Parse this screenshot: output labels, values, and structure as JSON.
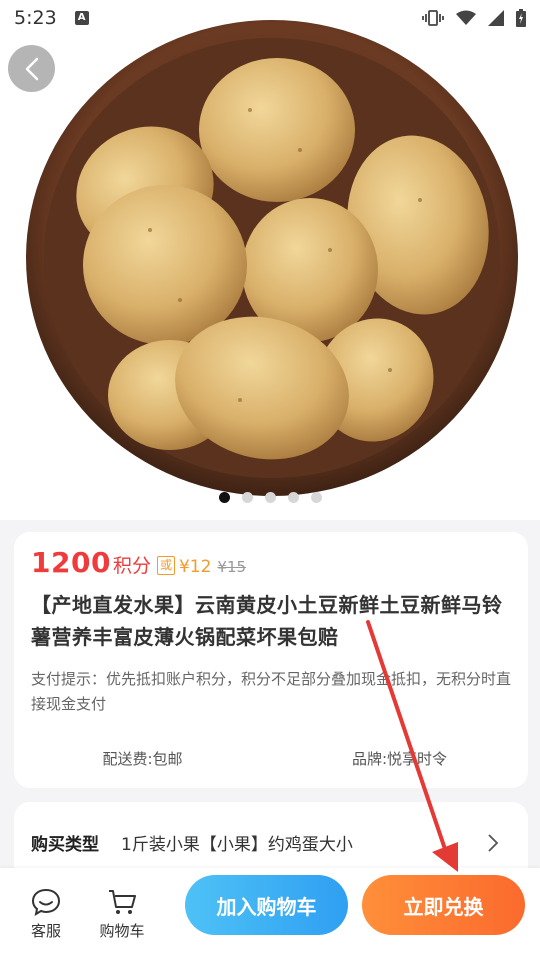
{
  "status_bar": {
    "time": "5:23",
    "notification_letter": "A",
    "icons": [
      "vibrate-icon",
      "wifi-icon",
      "signal-icon",
      "battery-charging-icon"
    ]
  },
  "hero": {
    "image_alt": "potato-bowl-image",
    "slide_count": 5,
    "active_slide": 1
  },
  "product": {
    "points_value": "1200",
    "points_unit": "积分",
    "or_badge": "或",
    "cash_price": "¥12",
    "original_price": "¥15",
    "title": "【产地直发水果】云南黄皮小土豆新鲜土豆新鲜马铃薯营养丰富皮薄火锅配菜坏果包赔",
    "payment_tip": "支付提示：优先抵扣账户积分，积分不足部分叠加现金抵扣，无积分时直接现金支付",
    "shipping": "配送费:包邮",
    "brand": "品牌:悦享时令"
  },
  "purchase_type": {
    "label": "购买类型",
    "value": "1斤装小果【小果】约鸡蛋大小"
  },
  "bottom_bar": {
    "service_label": "客服",
    "cart_label": "购物车",
    "add_to_cart": "加入购物车",
    "buy_now": "立即兑换"
  },
  "colors": {
    "price_red": "#ef3b3b",
    "accent_orange": "#f39a2b",
    "cart_button_blue": "#2f9ff2",
    "buy_button_orange": "#fb6a2d",
    "annotation_red": "#e53935"
  }
}
